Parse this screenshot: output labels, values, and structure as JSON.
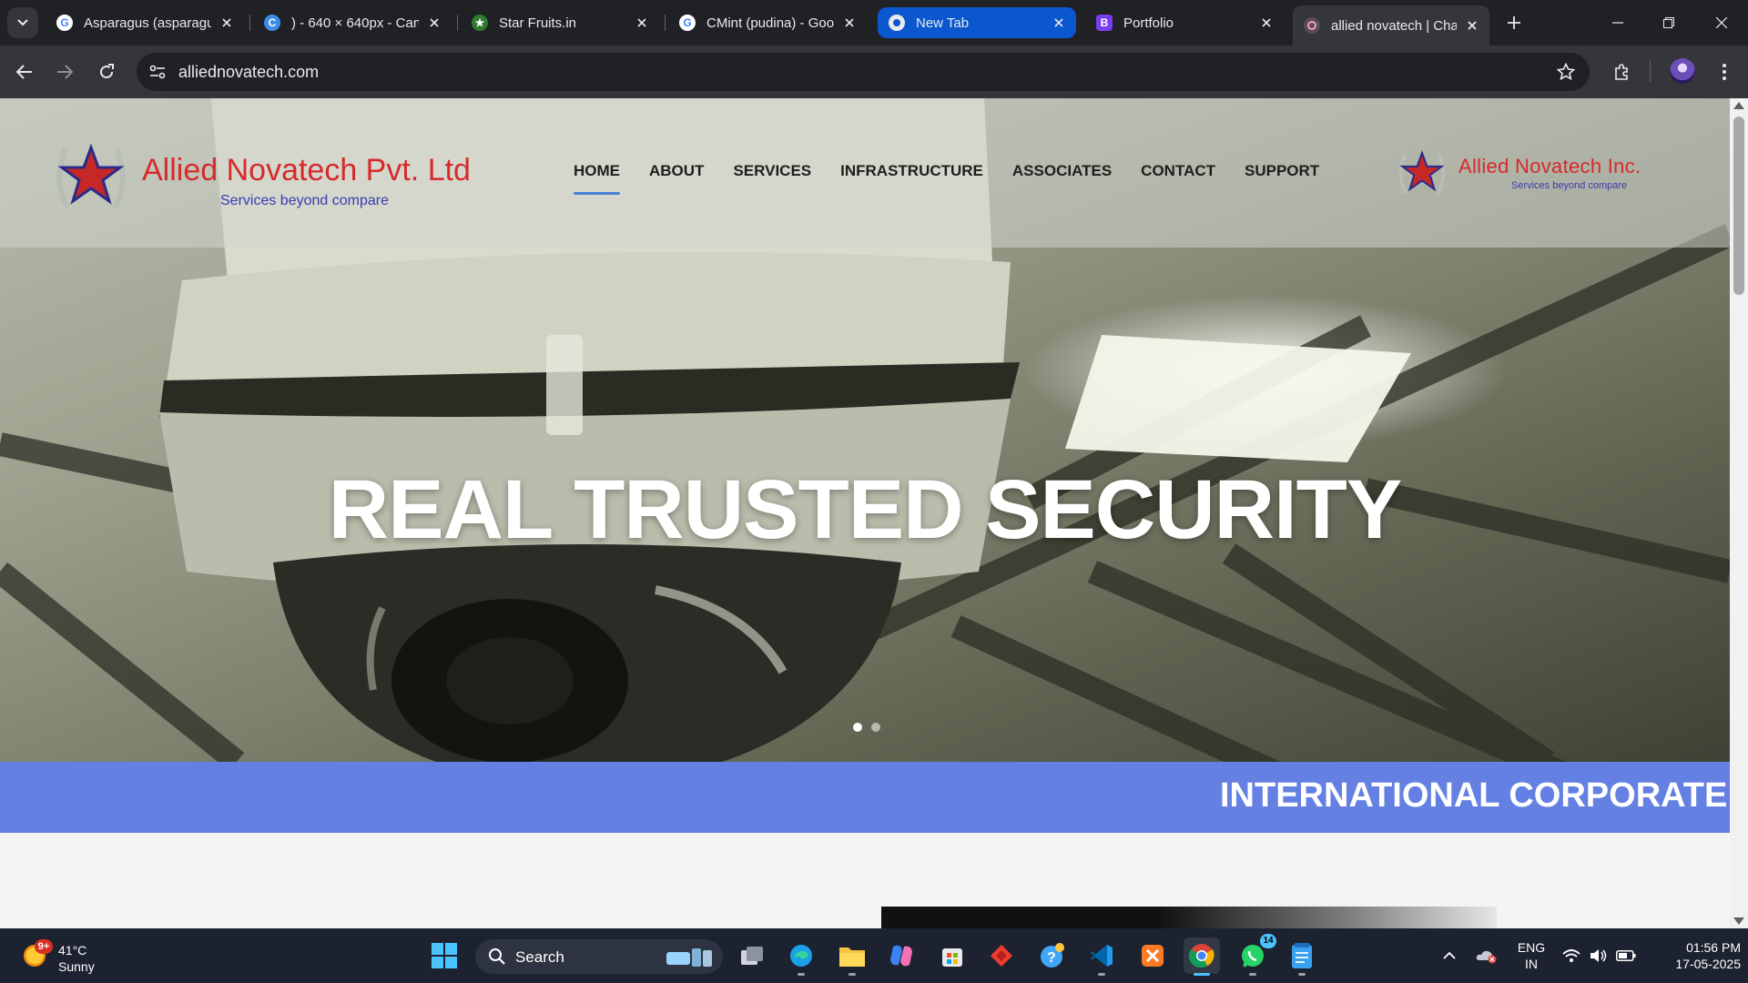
{
  "browser": {
    "tabs": [
      {
        "title": "Asparagus (asparagu",
        "favicon": "google-icon"
      },
      {
        "title": ") - 640 × 640px - Can",
        "favicon": "canva-icon"
      },
      {
        "title": "Star Fruits.in",
        "favicon": "star-fruits-icon"
      },
      {
        "title": "CMint (pudina) - Goo",
        "favicon": "google-icon"
      },
      {
        "title": "New Tab",
        "favicon": "chrome-icon"
      },
      {
        "title": "Portfolio",
        "favicon": "bootstrap-icon"
      },
      {
        "title": "allied novatech | Cha",
        "favicon": "chatgpt-icon"
      }
    ],
    "active_tab_index": 6,
    "highlighted_tab_index": 4,
    "address": "alliednovatech.com"
  },
  "site": {
    "logo_left": {
      "brand": "Allied Novatech Pvt. Ltd",
      "tagline": "Services beyond compare"
    },
    "logo_right": {
      "brand": "Allied Novatech Inc.",
      "tagline": "Services beyond compare"
    },
    "nav": [
      "HOME",
      "ABOUT",
      "SERVICES",
      "INFRASTRUCTURE",
      "ASSOCIATES",
      "CONTACT",
      "SUPPORT"
    ],
    "active_nav": "HOME",
    "hero_headline": "REAL TRUSTED SECURITY",
    "slider_dots": 2,
    "slider_active_dot": 0,
    "ticker_text": "INTERNATIONAL CORPORATE C",
    "colors": {
      "ticker_bg": "#6480e2",
      "brand_red": "#d52b2b",
      "brand_blue": "#3b3bb0",
      "nav_active": "#4a7fd6"
    }
  },
  "taskbar": {
    "weather": {
      "temp": "41°C",
      "condition": "Sunny",
      "badge": "9+"
    },
    "search_placeholder": "Search",
    "apps": [
      "windows-start-icon",
      "search-icon",
      "task-view-icon",
      "edge-icon",
      "file-explorer-icon",
      "copilot-icon",
      "microsoft-store-icon",
      "anydesk-icon",
      "help-icon",
      "vscode-icon",
      "xampp-icon",
      "chrome-icon",
      "whatsapp-icon",
      "notepad-icon"
    ],
    "whatsapp_badge": "14",
    "language": {
      "line1": "ENG",
      "line2": "IN"
    },
    "clock": {
      "time": "01:56 PM",
      "date": "17-05-2025"
    }
  }
}
